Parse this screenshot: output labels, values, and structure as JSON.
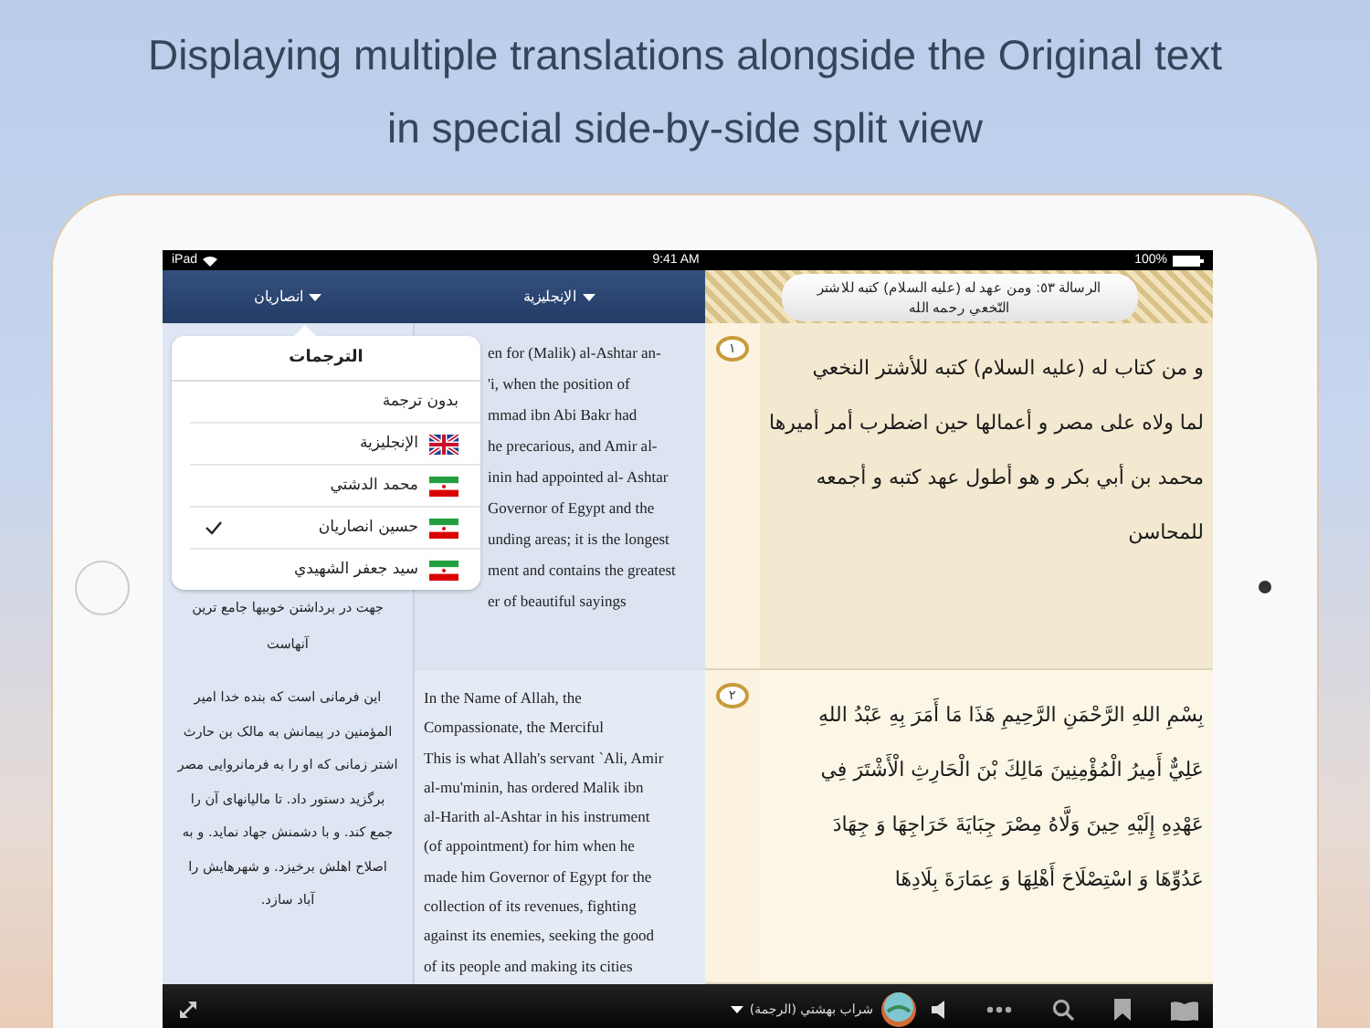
{
  "headline": "Displaying multiple translations alongside the Original text in special side-by-side split view",
  "status_bar": {
    "device": "iPad",
    "time": "9:41 AM",
    "battery": "100%"
  },
  "translation_columns": [
    {
      "label": "الإنجليزية"
    },
    {
      "label": "انصاريان"
    }
  ],
  "translations_popover": {
    "title": "الترجمات",
    "items": [
      {
        "label": "بدون ترجمة",
        "kind": "plain",
        "selected": false
      },
      {
        "label": "الإنجليزية",
        "kind": "british",
        "selected": false
      },
      {
        "label": "محمد الدشتي",
        "kind": "iranian",
        "selected": false
      },
      {
        "label": "حسين انصاريان",
        "kind": "iranian",
        "selected": true
      },
      {
        "label": "سيد جعفر الشهيدي",
        "kind": "iranian",
        "selected": false
      }
    ]
  },
  "chapter_title": "الرسالة ٥٣: ومن عهد له (عليه السلام) كتبه للاشتر النّخعي رحمه الله",
  "passages": [
    {
      "number": "١",
      "original": [
        "و من كتاب له (عليه السلام) كتبه للأشتر النخعي",
        "لما ولاه على مصر و أعمالها حين اضطرب أمر أميرها",
        "محمد بن أبي بكر و هو أطول عهد كتبه و أجمعه",
        "للمحاسن"
      ],
      "english": [
        "en for (Malik) al-Ashtar an-",
        "'i, when the position of",
        "mmad ibn Abi Bakr had",
        "he precarious, and Amir al-",
        "inin had appointed al- Ashtar",
        "Governor of Egypt and the",
        "unding areas; it is the longest",
        "ment and contains the greatest",
        "er of beautiful sayings"
      ],
      "persian": [
        "جهت در برداشتن خوبيها جامع ترين",
        "آنهاست"
      ]
    },
    {
      "number": "٢",
      "original": [
        "بِسْمِ اللهِ الرَّحْمَنِ الرَّحِيمِ هَذَا مَا أَمَرَ بِهِ عَبْدُ اللهِ",
        "عَلِيٌّ أَمِيرُ الْمُؤْمِنِينَ مَالِكَ بْنَ الْحَارِثِ الْأَشْتَرَ فِي",
        "عَهْدِهِ إِلَيْهِ حِينَ وَلَّاهُ مِصْرَ جِبَايَةَ خَرَاجِهَا وَ جِهَادَ",
        "عَدُوِّهَا وَ اسْتِصْلَاحَ أَهْلِهَا وَ عِمَارَةَ بِلَادِهَا"
      ],
      "english": [
        "In the Name of Allah, the",
        "Compassionate, the Merciful",
        "This is what Allah's servant `Ali, Amir",
        "al-mu'minin, has ordered Malik ibn",
        "al-Harith al-Ashtar in his instrument",
        "(of appointment) for him when he",
        "made him Governor of Egypt for the",
        "collection of its revenues, fighting",
        "against its enemies, seeking the good",
        "of its people and making its cities"
      ],
      "persian": [
        "اين فرمانى است كه بنده خدا امير",
        "المؤمنين در پيمانش به مالک بن حارث",
        "اشتر زمانى كه او را به فرمانروايى مصر",
        "برگزيد دستور داد. تا ماليانهاى آن را",
        "جمع كند. و با دشمنش جهاد نمايد. و به",
        "اصلاح اهلش برخيزد. و شهرهايش را",
        "آباد سازد."
      ]
    }
  ],
  "bottom_bar": {
    "translation_label": "شراب بهشتي (الرجمة)"
  }
}
